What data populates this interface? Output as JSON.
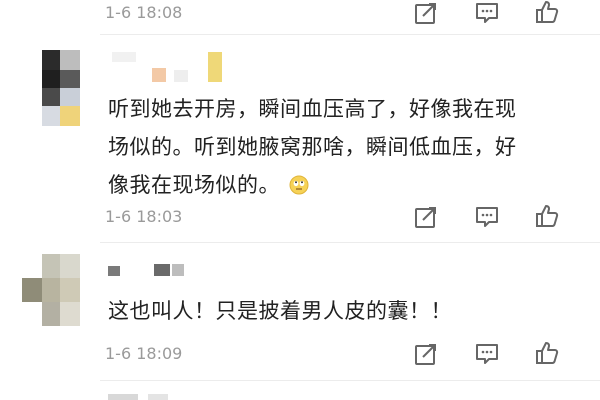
{
  "comments": [
    {
      "timestamp": "1-6 18:08"
    },
    {
      "text_lines": [
        "听到她去开房，瞬间血压高了，好像我在现",
        "场似的。听到她腋窝那啥，瞬间低血压，好",
        "像我在现场似的。"
      ],
      "emoji": "eye-roll-emoji",
      "timestamp": "1-6 18:03"
    },
    {
      "text_lines": [
        "这也叫人！只是披着男人皮的囊！！"
      ],
      "timestamp": "1-6 18:09"
    }
  ],
  "action_icons": [
    "edit-icon",
    "comment-icon",
    "like-icon"
  ],
  "colors": {
    "muted": "#9a9a9a",
    "text": "#222222",
    "divider": "#ececec",
    "highlight": "#e8c95a"
  }
}
